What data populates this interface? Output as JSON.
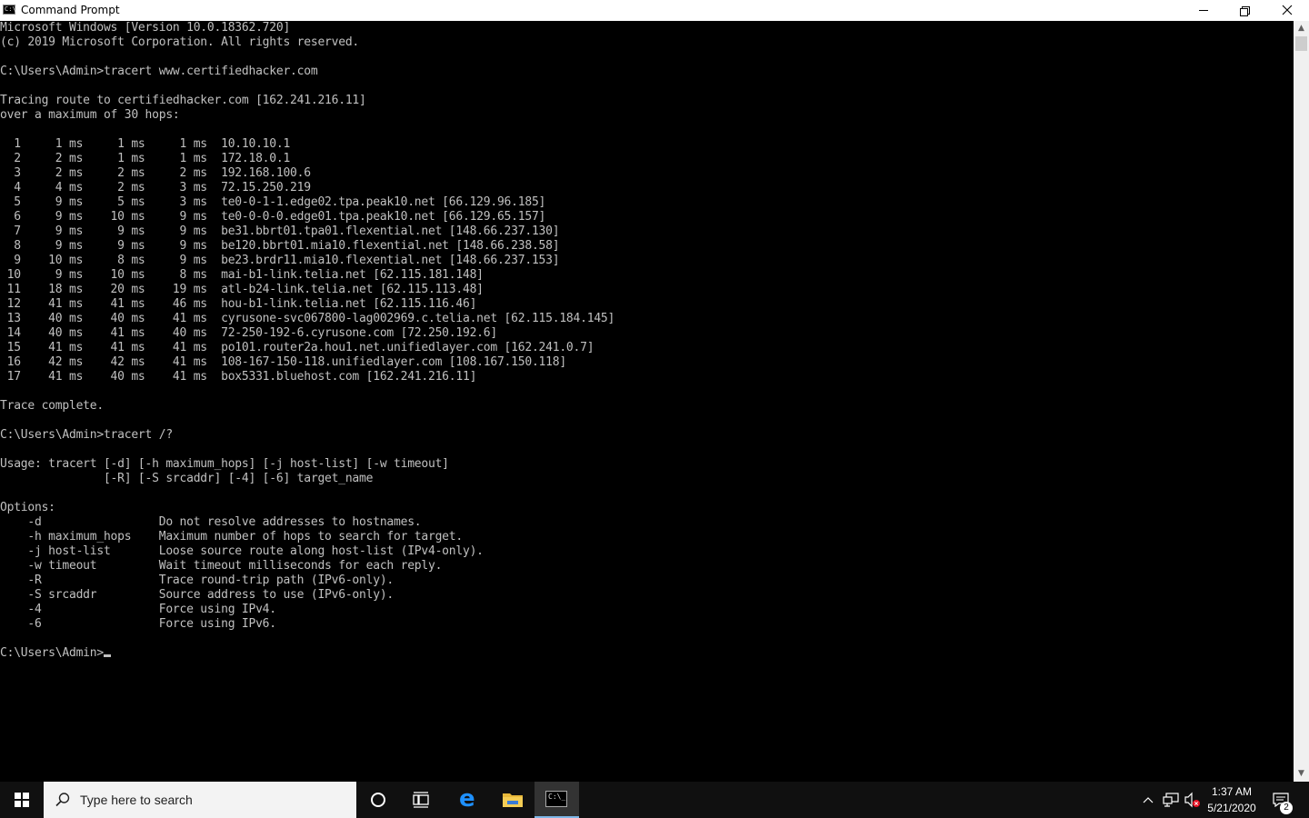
{
  "window": {
    "title": "Command Prompt",
    "icon_text": "C:\\"
  },
  "console": {
    "lines": [
      "Microsoft Windows [Version 10.0.18362.720]",
      "(c) 2019 Microsoft Corporation. All rights reserved.",
      "",
      "C:\\Users\\Admin>tracert www.certifiedhacker.com",
      "",
      "Tracing route to certifiedhacker.com [162.241.216.11]",
      "over a maximum of 30 hops:",
      "",
      "  1     1 ms     1 ms     1 ms  10.10.10.1",
      "  2     2 ms     1 ms     1 ms  172.18.0.1",
      "  3     2 ms     2 ms     2 ms  192.168.100.6",
      "  4     4 ms     2 ms     3 ms  72.15.250.219",
      "  5     9 ms     5 ms     3 ms  te0-0-1-1.edge02.tpa.peak10.net [66.129.96.185]",
      "  6     9 ms    10 ms     9 ms  te0-0-0-0.edge01.tpa.peak10.net [66.129.65.157]",
      "  7     9 ms     9 ms     9 ms  be31.bbrt01.tpa01.flexential.net [148.66.237.130]",
      "  8     9 ms     9 ms     9 ms  be120.bbrt01.mia10.flexential.net [148.66.238.58]",
      "  9    10 ms     8 ms     9 ms  be23.brdr11.mia10.flexential.net [148.66.237.153]",
      " 10     9 ms    10 ms     8 ms  mai-b1-link.telia.net [62.115.181.148]",
      " 11    18 ms    20 ms    19 ms  atl-b24-link.telia.net [62.115.113.48]",
      " 12    41 ms    41 ms    46 ms  hou-b1-link.telia.net [62.115.116.46]",
      " 13    40 ms    40 ms    41 ms  cyrusone-svc067800-lag002969.c.telia.net [62.115.184.145]",
      " 14    40 ms    41 ms    40 ms  72-250-192-6.cyrusone.com [72.250.192.6]",
      " 15    41 ms    41 ms    41 ms  po101.router2a.hou1.net.unifiedlayer.com [162.241.0.7]",
      " 16    42 ms    42 ms    41 ms  108-167-150-118.unifiedlayer.com [108.167.150.118]",
      " 17    41 ms    40 ms    41 ms  box5331.bluehost.com [162.241.216.11]",
      "",
      "Trace complete.",
      "",
      "C:\\Users\\Admin>tracert /?",
      "",
      "Usage: tracert [-d] [-h maximum_hops] [-j host-list] [-w timeout]",
      "               [-R] [-S srcaddr] [-4] [-6] target_name",
      "",
      "Options:",
      "    -d                 Do not resolve addresses to hostnames.",
      "    -h maximum_hops    Maximum number of hops to search for target.",
      "    -j host-list       Loose source route along host-list (IPv4-only).",
      "    -w timeout         Wait timeout milliseconds for each reply.",
      "    -R                 Trace round-trip path (IPv6-only).",
      "    -S srcaddr         Source address to use (IPv6-only).",
      "    -4                 Force using IPv4.",
      "    -6                 Force using IPv6.",
      ""
    ],
    "prompt": "C:\\Users\\Admin>"
  },
  "taskbar": {
    "search_placeholder": "Type here to search",
    "clock_time": "1:37 AM",
    "clock_date": "5/21/2020",
    "notification_count": "2"
  },
  "colors": {
    "console_bg": "#000000",
    "console_fg": "#c0c0c0",
    "taskbar_bg": "#101010",
    "edge_blue": "#1e90ff"
  }
}
